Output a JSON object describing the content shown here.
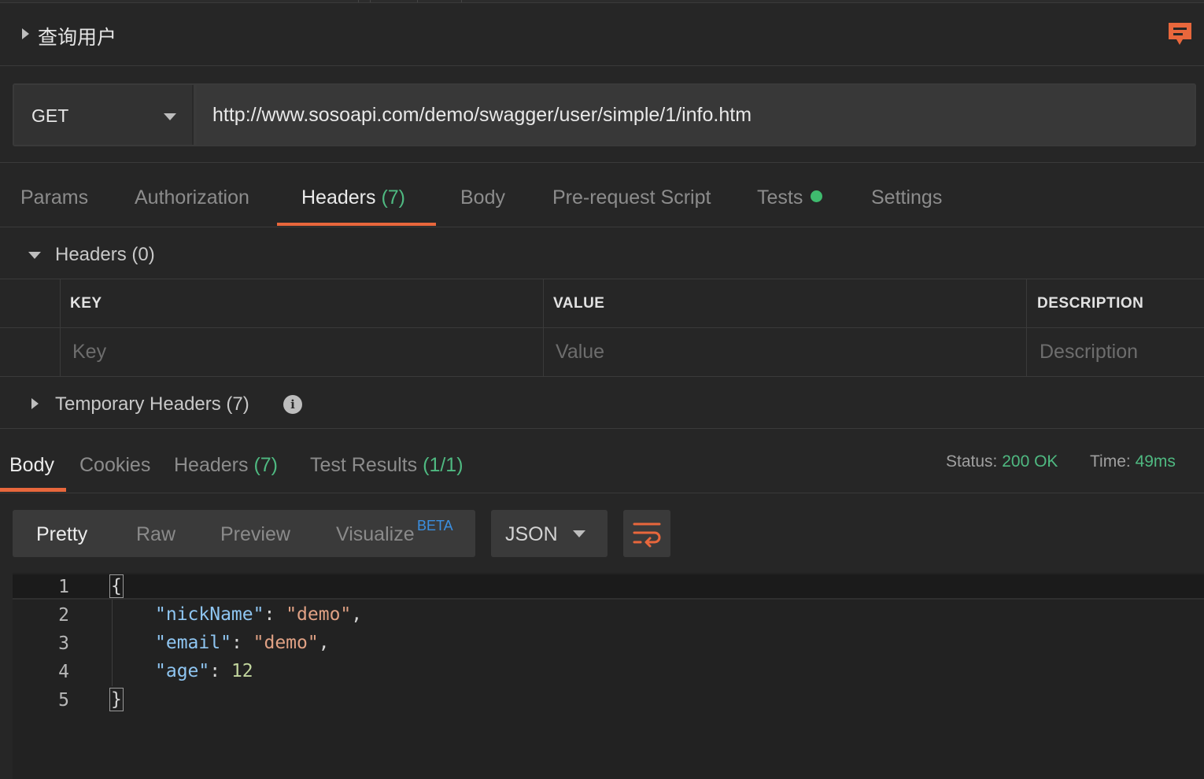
{
  "request": {
    "title": "查询用户",
    "method": "GET",
    "url": "http://www.sosoapi.com/demo/swagger/user/simple/1/info.htm"
  },
  "request_tabs": [
    {
      "label": "Params"
    },
    {
      "label": "Authorization"
    },
    {
      "label": "Headers",
      "count": "(7)"
    },
    {
      "label": "Body"
    },
    {
      "label": "Pre-request Script"
    },
    {
      "label": "Tests"
    },
    {
      "label": "Settings"
    }
  ],
  "headers_section": {
    "title": "Headers",
    "count": "(0)",
    "columns": [
      "KEY",
      "VALUE",
      "DESCRIPTION"
    ],
    "placeholders": {
      "key": "Key",
      "value": "Value",
      "description": "Description"
    }
  },
  "temporary_headers": {
    "title": "Temporary Headers",
    "count": "(7)"
  },
  "response_tabs": [
    {
      "label": "Body"
    },
    {
      "label": "Cookies"
    },
    {
      "label": "Headers",
      "count": "(7)"
    },
    {
      "label": "Test Results",
      "count": "(1/1)"
    }
  ],
  "response_status": {
    "status_label": "Status:",
    "status_value": "200 OK",
    "time_label": "Time:",
    "time_value": "49ms"
  },
  "format_bar": {
    "modes": [
      "Pretty",
      "Raw",
      "Preview",
      "Visualize"
    ],
    "beta": "BETA",
    "language": "JSON"
  },
  "code": {
    "line_numbers": [
      "1",
      "2",
      "3",
      "4",
      "5"
    ],
    "open_brace": "{",
    "close_brace": "}",
    "fields": [
      {
        "key": "\"nickName\"",
        "value": "\"demo\"",
        "trail": ","
      },
      {
        "key": "\"email\"",
        "value": "\"demo\"",
        "trail": ","
      },
      {
        "key": "\"age\"",
        "value": "12",
        "trail": ""
      }
    ]
  },
  "colors": {
    "accent": "#e8673c",
    "count_green": "#4fb981",
    "beta_blue": "#3b8fe0",
    "background": "#262626"
  },
  "icons": [
    "caret-right-icon",
    "comment-icon",
    "caret-down-icon",
    "info-icon",
    "wrap-lines-icon"
  ]
}
